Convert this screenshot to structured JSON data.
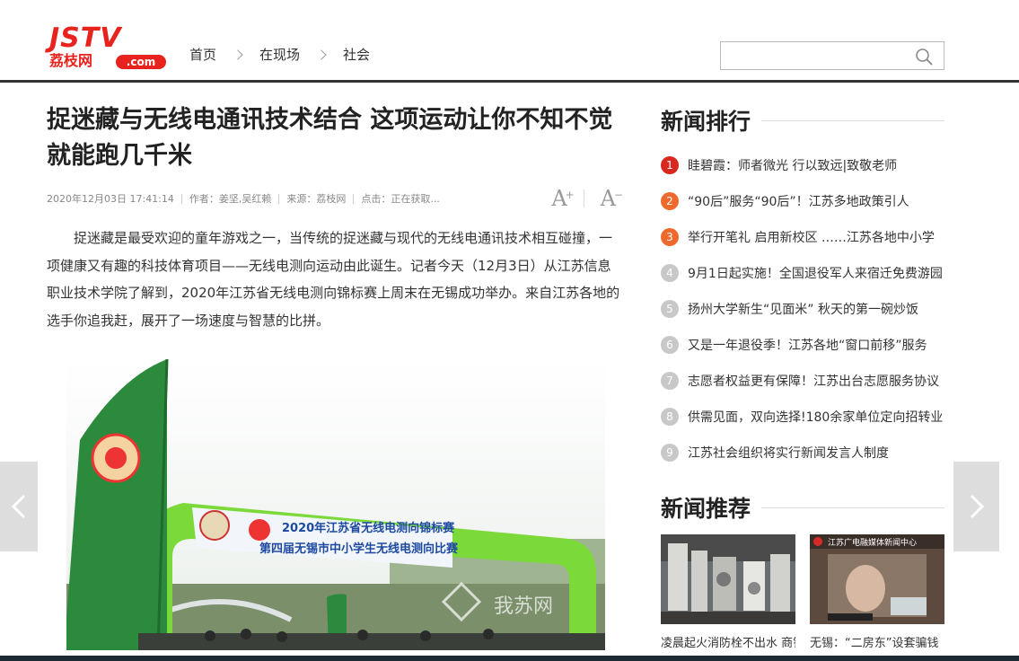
{
  "logo": {
    "top": "JSTV",
    "bottom": "荔枝网",
    "suffix": ".com"
  },
  "breadcrumb": [
    "首页",
    "在现场",
    "社会"
  ],
  "search": {
    "placeholder": "",
    "value": ""
  },
  "article": {
    "title": "捉迷藏与无线电通讯技术结合 这项运动让你不知不觉就能跑几千米",
    "meta": {
      "date": "2020年12月03日 17:41:14",
      "author": "作者：姜坚,吴红赖",
      "source": "来源：荔枝网",
      "clicks": "点击：正在获取..."
    },
    "font_controls": {
      "increase": "A",
      "increase_sup": "+",
      "decrease": "A",
      "decrease_sup": "−"
    },
    "body": "捉迷藏是最受欢迎的童年游戏之一，当传统的捉迷藏与现代的无线电通讯技术相互碰撞，一项健康又有趣的科技体育项目——无线电测向运动由此诞生。记者今天（12月3日）从江苏信息职业技术学院了解到，2020年江苏省无线电测向锦标赛上周末在无锡成功举办。来自江苏各地的选手你追我赶，展开了一场速度与智慧的比拼。",
    "photo": {
      "banner_line1": "2020年江苏省无线电测向锦标赛",
      "banner_line2": "第四届无锡市中小学生无线电测向比赛",
      "watermark": "我苏网"
    }
  },
  "sidebar": {
    "ranking_title": "新闻排行",
    "ranking": [
      {
        "num": "1",
        "text": "眭碧霞：师者微光 行以致远|致敬老师",
        "color": "#d9281f"
      },
      {
        "num": "2",
        "text": "“90后”服务“90后”！江苏多地政策引人",
        "color": "#ee6a2c"
      },
      {
        "num": "3",
        "text": "举行开笔礼 启用新校区 ……江苏各地中小学",
        "color": "#ee6a2c"
      },
      {
        "num": "4",
        "text": "9月1日起实施！全国退役军人来宿迁免费游园",
        "color": "#c8c8c8"
      },
      {
        "num": "5",
        "text": "扬州大学新生“见面米” 秋天的第一碗炒饭",
        "color": "#c8c8c8"
      },
      {
        "num": "6",
        "text": "又是一年退役季！江苏各地“窗口前移”服务",
        "color": "#c8c8c8"
      },
      {
        "num": "7",
        "text": "志愿者权益更有保障！江苏出台志愿服务协议",
        "color": "#c8c8c8"
      },
      {
        "num": "8",
        "text": "供需见面，双向选择!180余家单位定向招转业",
        "color": "#c8c8c8"
      },
      {
        "num": "9",
        "text": "江苏社会组织将实行新闻发言人制度",
        "color": "#c8c8c8"
      }
    ],
    "recommend_title": "新闻推荐",
    "recommend": [
      {
        "text": "凌晨起火消防栓不出水 商铺"
      },
      {
        "text": "无锡：“二房东”设套骗钱",
        "img_caption": "江苏广电融媒体新闻中心"
      }
    ]
  }
}
